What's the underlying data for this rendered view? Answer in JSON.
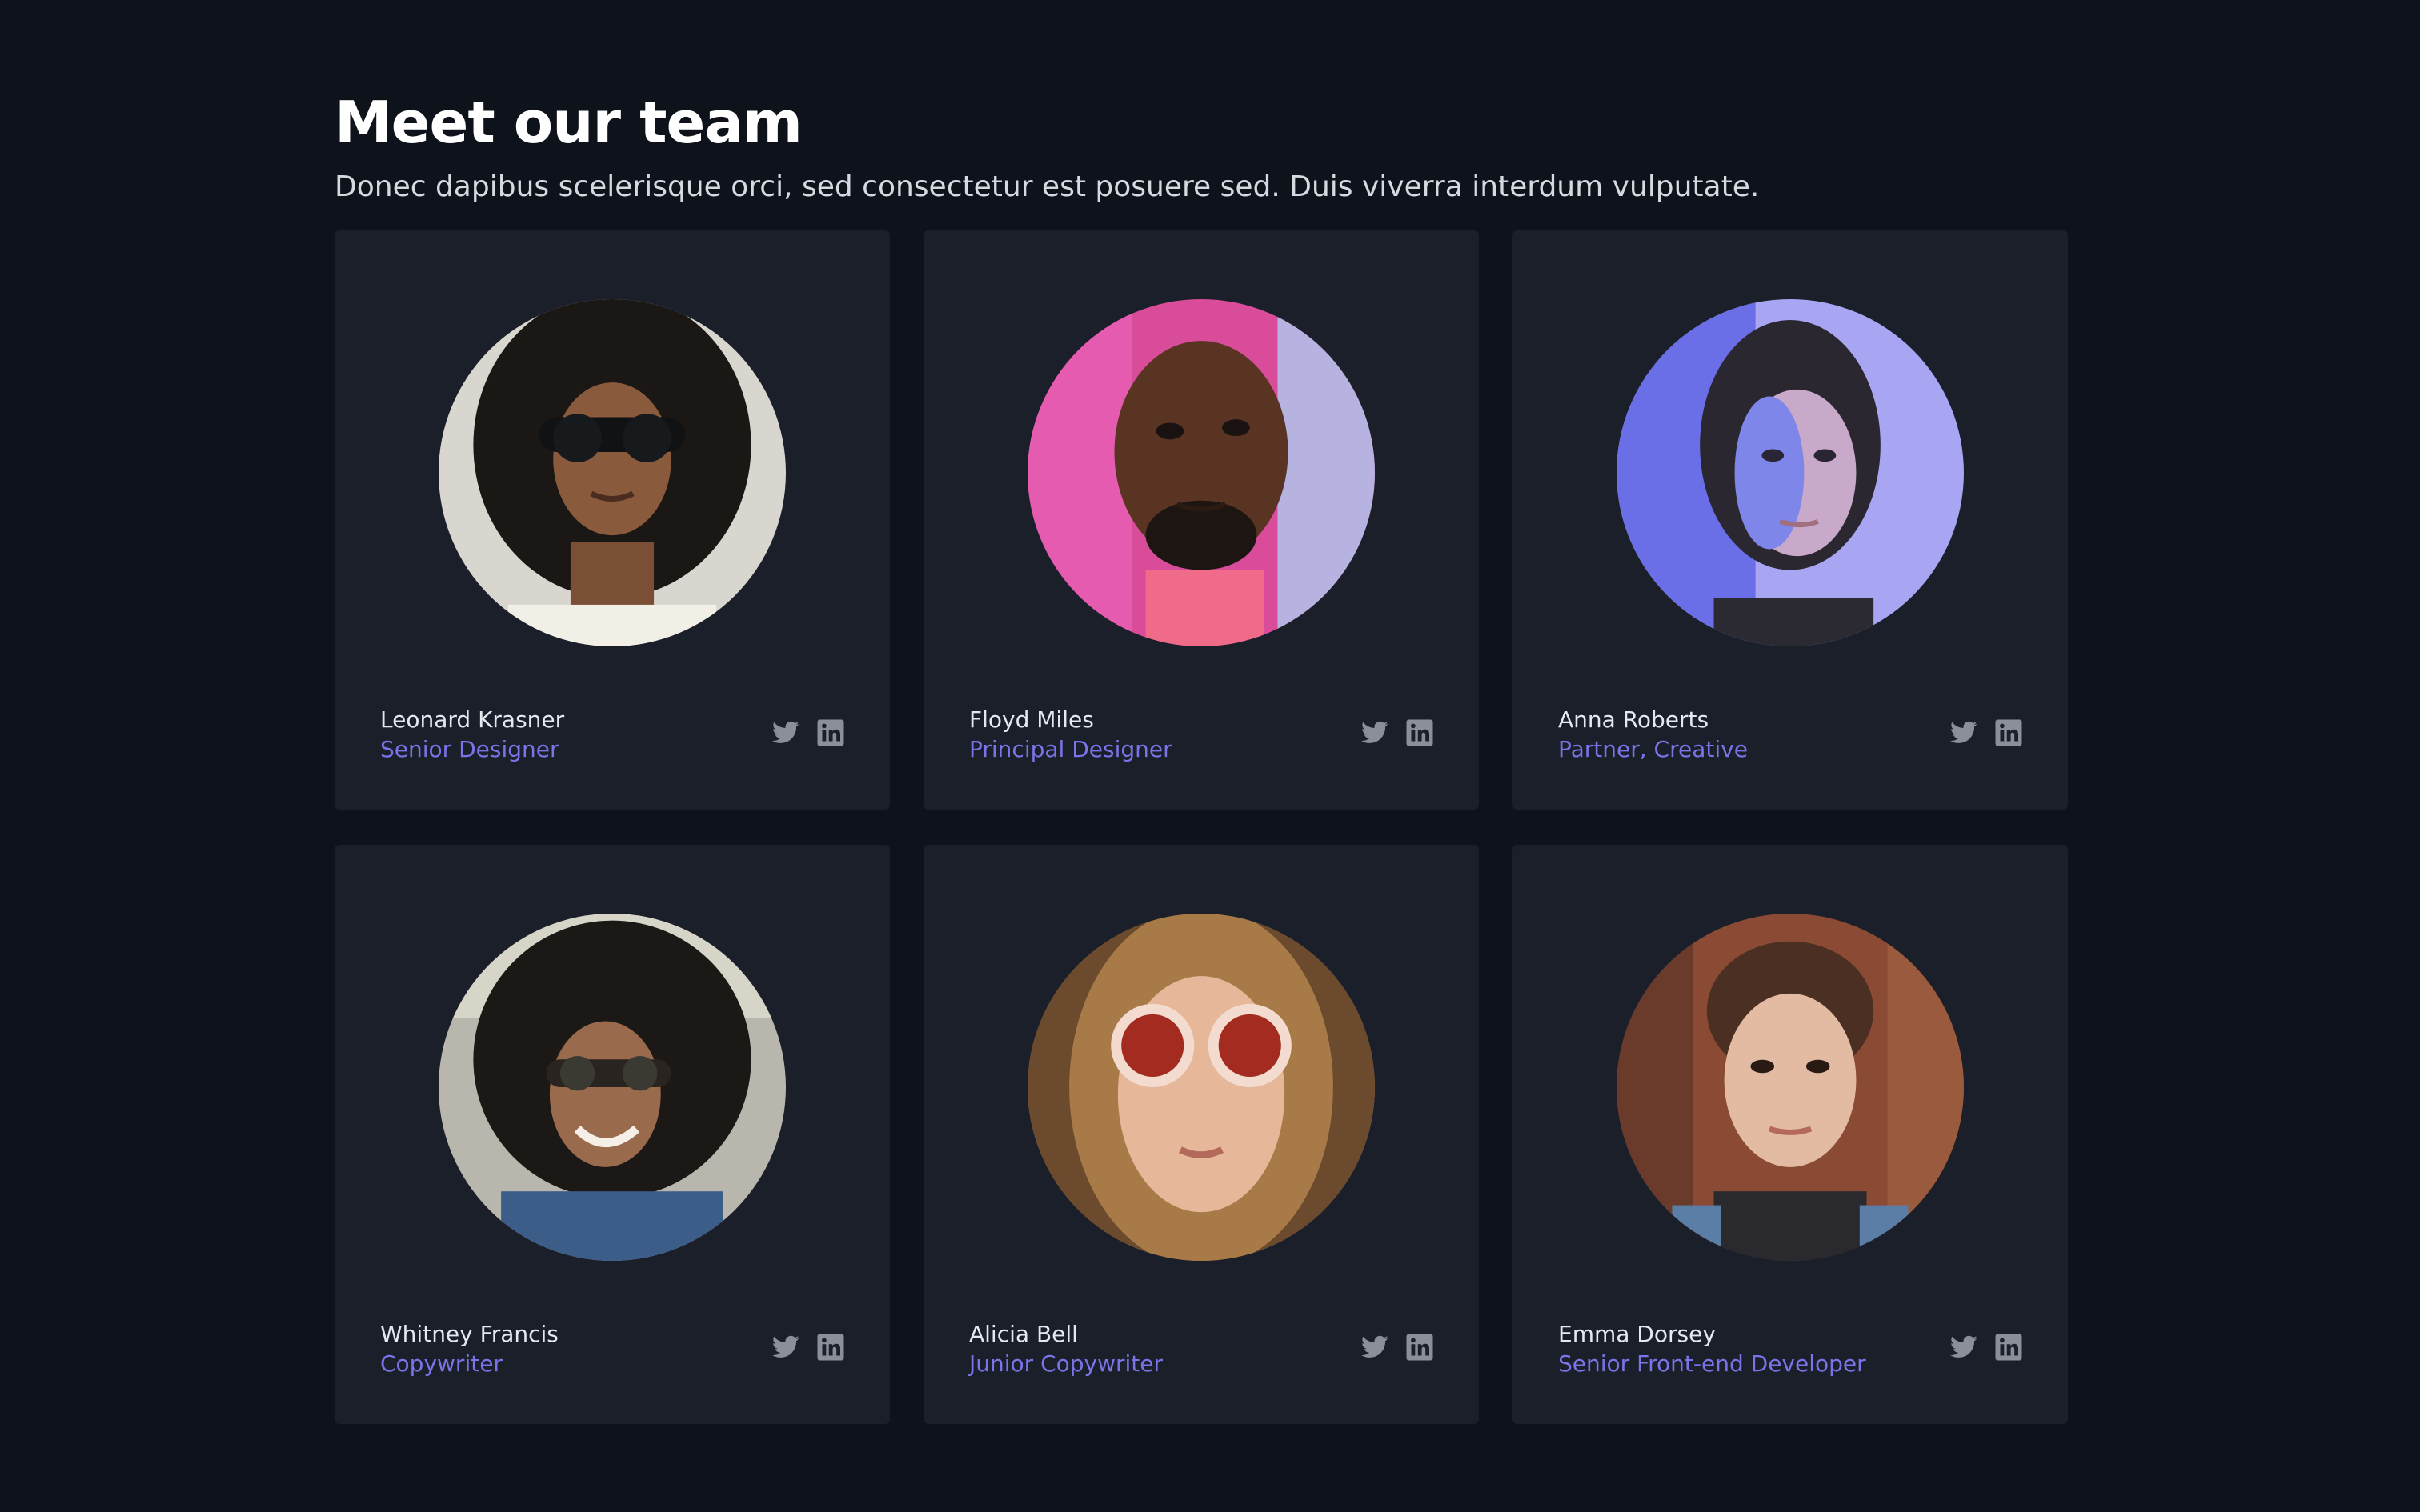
{
  "header": {
    "title": "Meet our team",
    "subtitle": "Donec dapibus scelerisque orci, sed consectetur est posuere sed. Duis viverra interdum vulputate."
  },
  "colors": {
    "background": "#0e121b",
    "card": "#1a1f2a",
    "role_accent": "#7b74e8",
    "icon": "#8a8f9a"
  },
  "team": [
    {
      "name": "Leonard Krasner",
      "role": "Senior Designer",
      "icons": [
        "twitter-icon",
        "linkedin-icon"
      ]
    },
    {
      "name": "Floyd Miles",
      "role": "Principal Designer",
      "icons": [
        "twitter-icon",
        "linkedin-icon"
      ]
    },
    {
      "name": "Anna Roberts",
      "role": "Partner, Creative",
      "icons": [
        "twitter-icon",
        "linkedin-icon"
      ]
    },
    {
      "name": "Whitney Francis",
      "role": "Copywriter",
      "icons": [
        "twitter-icon",
        "linkedin-icon"
      ]
    },
    {
      "name": "Alicia Bell",
      "role": "Junior Copywriter",
      "icons": [
        "twitter-icon",
        "linkedin-icon"
      ]
    },
    {
      "name": "Emma Dorsey",
      "role": "Senior Front-end Developer",
      "icons": [
        "twitter-icon",
        "linkedin-icon"
      ]
    }
  ]
}
